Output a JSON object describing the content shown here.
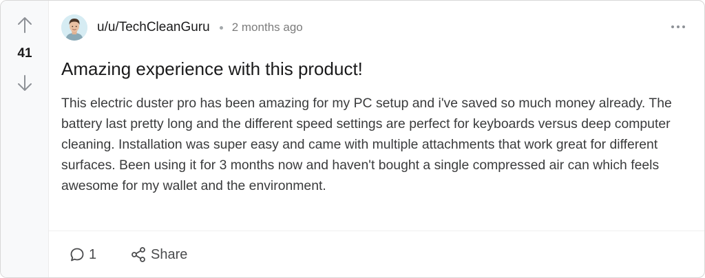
{
  "vote": {
    "count": "41",
    "upvote_icon": "arrow-up-icon",
    "downvote_icon": "arrow-down-icon"
  },
  "post": {
    "username": "u/u/TechCleanGuru",
    "timestamp": "2 months ago",
    "title": "Amazing experience with this product!",
    "body": "This electric duster pro has been amazing for my PC setup and i've saved so much money already. The battery last pretty long and the different speed settings are perfect for keyboards versus deep computer cleaning. Installation was super easy and came with multiple attachments that work great for different surfaces. Been using it for 3 months now and haven't bought a single compressed air can which feels awesome for my wallet and the environment."
  },
  "footer": {
    "comments_count": "1",
    "share_label": "Share"
  },
  "colors": {
    "vote_column_bg": "#f8f9fa",
    "text_primary": "#1a1a1b",
    "text_muted": "#7c7c7c",
    "border": "#d7d7d7"
  }
}
